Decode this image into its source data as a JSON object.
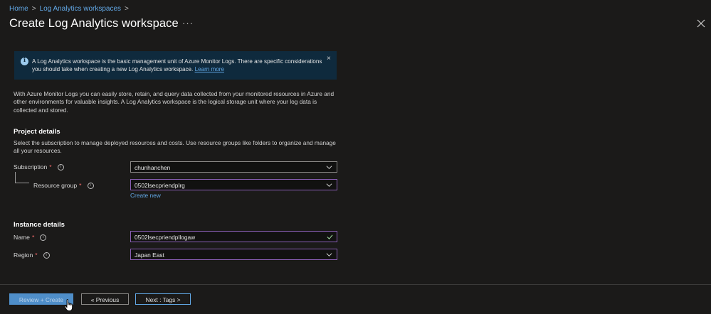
{
  "breadcrumb": {
    "home": "Home",
    "separator": ">",
    "workspaces": "Log Analytics workspaces"
  },
  "header": {
    "title": "Create Log Analytics workspace",
    "more": "···"
  },
  "banner": {
    "text": "A Log Analytics workspace is the basic management unit of Azure Monitor Logs. There are specific considerations you should take when creating a new Log Analytics workspace.",
    "link": "Learn more",
    "close": "×"
  },
  "intro": "With Azure Monitor Logs you can easily store, retain, and query data collected from your monitored resources in Azure and other environments for valuable insights. A Log Analytics workspace is the logical storage unit where your log data is collected and stored.",
  "project": {
    "heading": "Project details",
    "description": "Select the subscription to manage deployed resources and costs. Use resource groups like folders to organize and manage all your resources.",
    "subscription_label": "Subscription",
    "subscription_value": "chunhanchen",
    "resource_group_label": "Resource group",
    "resource_group_value": "0502lsecpriendplrg",
    "create_new": "Create new",
    "required_mark": "*",
    "info_glyph": "i"
  },
  "instance": {
    "heading": "Instance details",
    "name_label": "Name",
    "name_value": "0502lsecpriendpllogaw",
    "region_label": "Region",
    "region_value": "Japan East"
  },
  "footer": {
    "review_create": "Review + Create",
    "previous": "« Previous",
    "next": "Next : Tags >"
  },
  "colors": {
    "background": "#1b1a19",
    "primary": "#4f8ec9",
    "link": "#62a8e6",
    "banner": "#0f2a3d",
    "required": "#ff6f6f"
  }
}
